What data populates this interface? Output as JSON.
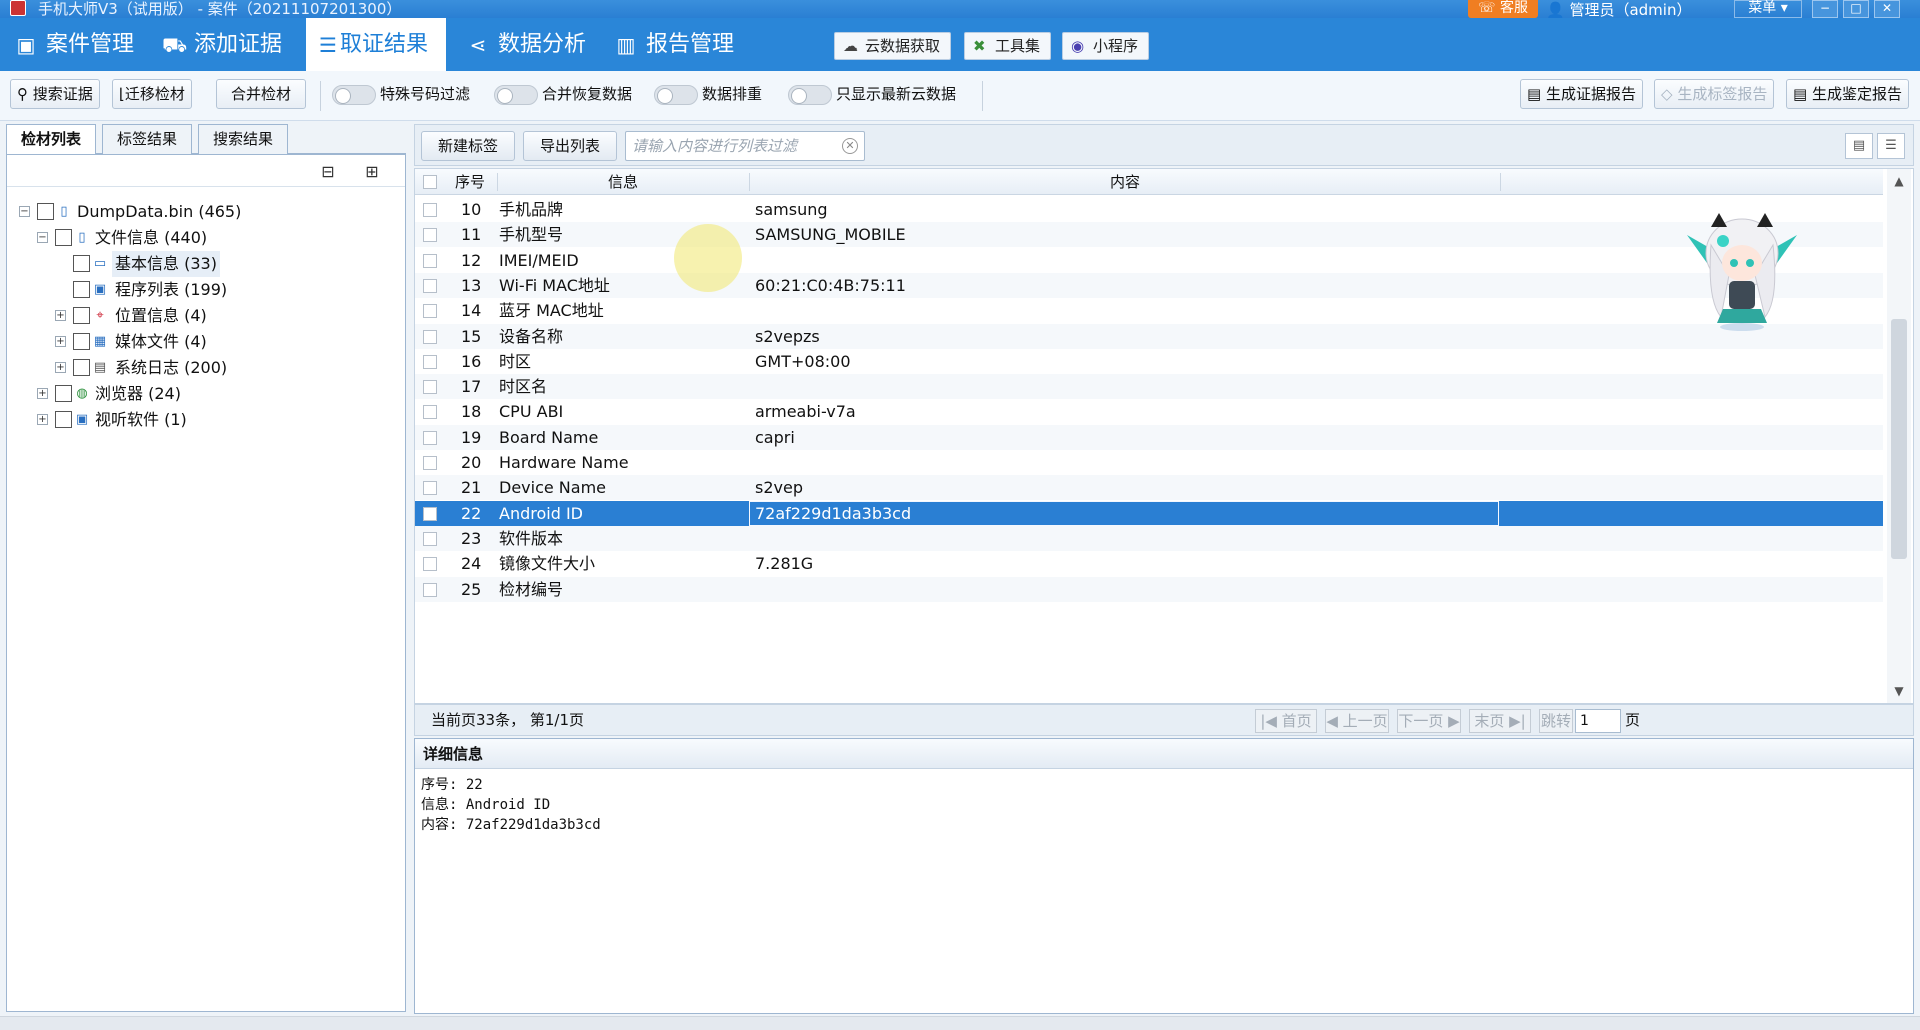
{
  "window": {
    "title": "手机大师V3（试用版） - 案件（20211107201300）",
    "support": "客服",
    "user": "管理员（admin）",
    "menu": "菜单",
    "controls": [
      "−",
      "□",
      "✕"
    ]
  },
  "nav": {
    "items": [
      {
        "label": "案件管理",
        "icon": "user-card-icon"
      },
      {
        "label": "添加证据",
        "icon": "truck-icon"
      },
      {
        "label": "取证结果",
        "icon": "list-doc-icon"
      },
      {
        "label": "数据分析",
        "icon": "share-icon"
      },
      {
        "label": "报告管理",
        "icon": "bars-icon"
      }
    ],
    "active_index": 2,
    "tools": [
      {
        "label": "云数据获取",
        "icon": "cloud-icon"
      },
      {
        "label": "工具集",
        "icon": "tools-icon"
      },
      {
        "label": "小程序",
        "icon": "miniapp-icon"
      }
    ]
  },
  "toolbar": {
    "search": "搜索证据",
    "migrate": "迁移检材",
    "merge": "合并检材",
    "toggles": [
      "特殊号码过滤",
      "合并恢复数据",
      "数据排重",
      "只显示最新云数据"
    ],
    "report_evidence": "生成证据报告",
    "report_tag": "生成标签报告",
    "report_appraisal": "生成鉴定报告"
  },
  "left": {
    "tabs": [
      "检材列表",
      "标签结果",
      "搜索结果"
    ],
    "tree": [
      {
        "label": "DumpData.bin (465)",
        "icon": "phone-icon",
        "level": 0,
        "expander": "−"
      },
      {
        "label": "文件信息 (440)",
        "icon": "phone-small-icon",
        "level": 1,
        "expander": "−"
      },
      {
        "label": "基本信息 (33)",
        "icon": "info-icon",
        "level": 2,
        "expander": ""
      },
      {
        "label": "程序列表 (199)",
        "icon": "app-list-icon",
        "level": 2,
        "expander": ""
      },
      {
        "label": "位置信息 (4)",
        "icon": "location-icon",
        "level": 2,
        "expander": "+"
      },
      {
        "label": "媒体文件 (4)",
        "icon": "film-icon",
        "level": 2,
        "expander": "+"
      },
      {
        "label": "系统日志 (200)",
        "icon": "log-icon",
        "level": 2,
        "expander": "+"
      },
      {
        "label": "浏览器 (24)",
        "icon": "globe-icon",
        "level": 1,
        "expander": "+"
      },
      {
        "label": "视听软件 (1)",
        "icon": "video-icon",
        "level": 1,
        "expander": "+"
      }
    ]
  },
  "main": {
    "new_tag": "新建标签",
    "export_list": "导出列表",
    "filter_placeholder": "请输入内容进行列表过滤",
    "columns": [
      "序号",
      "信息",
      "内容"
    ],
    "rows": [
      {
        "no": "10",
        "info": "手机品牌",
        "content": "samsung"
      },
      {
        "no": "11",
        "info": "手机型号",
        "content": "SAMSUNG_MOBILE"
      },
      {
        "no": "12",
        "info": "IMEI/MEID",
        "content": ""
      },
      {
        "no": "13",
        "info": "Wi-Fi MAC地址",
        "content": "60:21:C0:4B:75:11"
      },
      {
        "no": "14",
        "info": "蓝牙 MAC地址",
        "content": ""
      },
      {
        "no": "15",
        "info": "设备名称",
        "content": "s2vepzs"
      },
      {
        "no": "16",
        "info": "时区",
        "content": "GMT+08:00"
      },
      {
        "no": "17",
        "info": "时区名",
        "content": ""
      },
      {
        "no": "18",
        "info": "CPU ABI",
        "content": "armeabi-v7a"
      },
      {
        "no": "19",
        "info": "Board Name",
        "content": "capri"
      },
      {
        "no": "20",
        "info": "Hardware Name",
        "content": ""
      },
      {
        "no": "21",
        "info": "Device Name",
        "content": "s2vep"
      },
      {
        "no": "22",
        "info": "Android ID",
        "content": "72af229d1da3b3cd"
      },
      {
        "no": "23",
        "info": "软件版本",
        "content": ""
      },
      {
        "no": "24",
        "info": "镜像文件大小",
        "content": "7.281G"
      },
      {
        "no": "25",
        "info": "检材编号",
        "content": ""
      }
    ],
    "selected_no": "22",
    "pager": {
      "summary": "当前页33条，  第1/1页",
      "first": "首页",
      "prev": "上一页",
      "next": "下一页",
      "last": "末页",
      "jump": "跳转",
      "page": "1",
      "page_unit": "页"
    }
  },
  "detail": {
    "title": "详细信息",
    "lines": [
      "序号: 22",
      "信息: Android ID",
      "内容: 72af229d1da3b3cd"
    ]
  }
}
